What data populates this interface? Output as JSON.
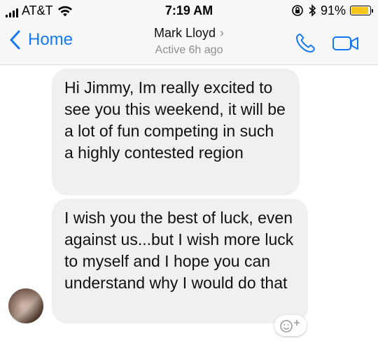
{
  "status_bar": {
    "carrier": "AT&T",
    "time": "7:19 AM",
    "battery_percent_text": "91%",
    "battery_level": 0.91,
    "icons": [
      "signal-icon",
      "wifi-icon",
      "rotation-lock-icon",
      "bluetooth-icon",
      "battery-icon"
    ]
  },
  "header": {
    "back_label": "Home",
    "contact_name": "Mark Lloyd",
    "chevron": "›",
    "status": "Active 6h ago",
    "icons": [
      "back-chevron-icon",
      "phone-icon",
      "video-camera-icon"
    ],
    "accent_color": "#1478f6"
  },
  "messages": [
    {
      "text": "Hi Jimmy, Im really excited to see you this weekend, it will be a lot of fun competing in such a highly contested region"
    },
    {
      "text": "I wish you the best of luck, even against us...but I wish more luck to myself and I hope you can understand why I would do that"
    }
  ],
  "bubble_color": "#f0f0f0",
  "reaction_icon": "add-reaction-icon"
}
